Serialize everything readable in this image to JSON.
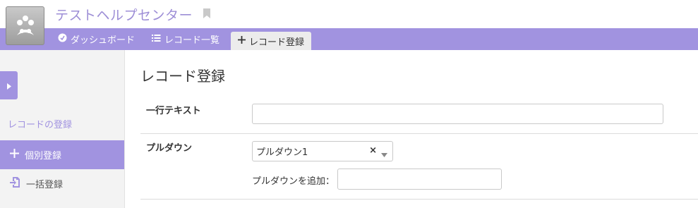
{
  "app": {
    "title": "テストヘルプセンター"
  },
  "tabs": [
    {
      "label": "ダッシュボード",
      "icon": "dashboard-icon"
    },
    {
      "label": "レコード一覧",
      "icon": "list-icon"
    },
    {
      "label": "レコード登録",
      "icon": "plus-icon",
      "active": true
    }
  ],
  "sidebar": {
    "section_title": "レコードの登録",
    "items": [
      {
        "label": "個別登録",
        "icon": "plus-icon",
        "active": true
      },
      {
        "label": "一括登録",
        "icon": "file-import-icon",
        "active": false
      }
    ]
  },
  "main": {
    "title": "レコード登録",
    "fields": {
      "text": {
        "label": "一行テキスト",
        "value": ""
      },
      "dropdown": {
        "label": "プルダウン",
        "selected": "プルダウン1",
        "clear": "×",
        "add_label": "プルダウンを追加：",
        "add_value": ""
      }
    }
  },
  "colors": {
    "accent": "#a193e0",
    "title": "#9d8ed6",
    "sidebar_bg": "#f3f3f3"
  }
}
